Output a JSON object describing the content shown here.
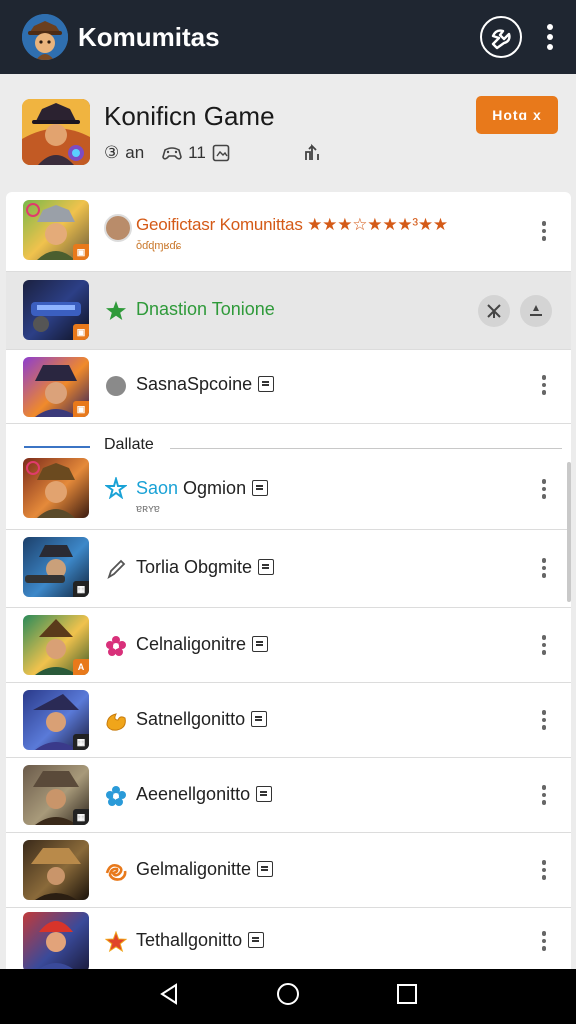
{
  "appbar": {
    "title": "Komumitas",
    "avatar_icon": "game-avatar",
    "action_icon": "tool-icon",
    "menu_icon": "more-vert-icon"
  },
  "game": {
    "title": "Konificn Game",
    "meta_left": "an",
    "meta_left_prefix": "③",
    "meta_mid": "11",
    "follow_label": "Hotɑ x"
  },
  "section": {
    "label": "Dallate"
  },
  "rows": [
    {
      "label": "Geoifictasr Komunittas ★★★☆★★★³★★",
      "sub": "ȱɗɖɱʁɗɕ",
      "icon": "avatar-icon",
      "label_color": "#d45a17"
    },
    {
      "label": "Dnastion Tonione",
      "icon": "green-star-icon",
      "label_color": "#2f9a3a"
    },
    {
      "label": "SasnaSpcoine",
      "icon": "gray-circle-icon",
      "label_color": "#222222"
    },
    {
      "label_prefix": "Saon",
      "label_rest": " Ogmion",
      "sub": "ɐʀʏɐ",
      "icon": "blue-star-icon",
      "label_color": "#1aa2d6"
    },
    {
      "label": "Torlia Obgmite",
      "icon": "pencil-icon",
      "label_color": "#222222"
    },
    {
      "label": "Celnaligonitre",
      "icon": "pink-flower-icon",
      "label_color": "#222222"
    },
    {
      "label": "Satnellgonitto",
      "icon": "orange-flame-icon",
      "label_color": "#222222"
    },
    {
      "label": "Aeenellgonitto",
      "icon": "blue-flower-icon",
      "label_color": "#222222"
    },
    {
      "label": "Gelmaligonitte",
      "icon": "orange-swirl-icon",
      "label_color": "#222222"
    },
    {
      "label": "Tethallgonitto",
      "icon": "red-star-icon",
      "label_color": "#222222"
    }
  ],
  "colors": {
    "appbar_bg": "#1f2631",
    "accent_orange": "#e8791b",
    "section_line": "#3b74c4"
  },
  "navbar": {
    "back_icon": "back-triangle-icon",
    "home_icon": "home-circle-icon",
    "recents_icon": "recents-square-icon"
  }
}
